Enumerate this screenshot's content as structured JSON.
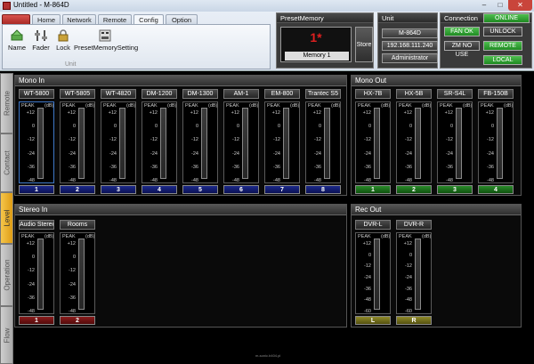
{
  "window": {
    "title": "Untitled - M-864D",
    "min": "–",
    "max": "□",
    "close": "✕"
  },
  "tabs": [
    {
      "label": "",
      "active": false
    },
    {
      "label": "Home",
      "active": false
    },
    {
      "label": "Network",
      "active": false
    },
    {
      "label": "Remote",
      "active": false
    },
    {
      "label": "Config",
      "active": true
    },
    {
      "label": "Option",
      "active": false
    }
  ],
  "ribbon": {
    "buttons": [
      {
        "label": "Name",
        "icon": "name-icon"
      },
      {
        "label": "Fader",
        "icon": "fader-icon"
      },
      {
        "label": "Lock",
        "icon": "lock-icon"
      },
      {
        "label": "PresetMemorySetting",
        "icon": "preset-memory-icon"
      }
    ],
    "group_label": "Unit"
  },
  "preset_memory": {
    "header": "PresetMemory",
    "number": "1*",
    "name": "Memory 1",
    "store_label": "Store"
  },
  "unit": {
    "header": "Unit",
    "model": "M-864D",
    "ip": "192.168.111.240",
    "user": "Administrator"
  },
  "connection": {
    "header": "Connection",
    "status": "ONLINE",
    "fan": "FAN OK",
    "unlock": "UNLOCK",
    "zm": "ZM NO USE",
    "remote": "REMOTE",
    "local": "LOCAL"
  },
  "side_tabs": [
    {
      "label": "Remote",
      "active": false
    },
    {
      "label": "Contact",
      "active": false
    },
    {
      "label": "Level",
      "active": true
    },
    {
      "label": "Operation",
      "active": false
    },
    {
      "label": "Flow",
      "active": false
    }
  ],
  "meter": {
    "peak": "PEAK",
    "unit": "(dB)",
    "ticks": [
      "+12",
      "0",
      "-12",
      "-24",
      "-36",
      "-48"
    ],
    "ticks_rec": [
      "+12",
      "0",
      "-12",
      "-24",
      "-36",
      "-48",
      "-60"
    ]
  },
  "mono_in": {
    "title": "Mono In",
    "channels": [
      {
        "name": "WT-5800",
        "index": "1"
      },
      {
        "name": "WT-5805",
        "index": "2"
      },
      {
        "name": "WT-4820",
        "index": "3"
      },
      {
        "name": "DM-1200",
        "index": "4"
      },
      {
        "name": "DM-1300",
        "index": "5"
      },
      {
        "name": "AM-1",
        "index": "6"
      },
      {
        "name": "EM-800",
        "index": "7"
      },
      {
        "name": "Trantec S5",
        "index": "8"
      }
    ]
  },
  "mono_out": {
    "title": "Mono Out",
    "channels": [
      {
        "name": "HX-7B",
        "index": "1"
      },
      {
        "name": "HX-5B",
        "index": "2"
      },
      {
        "name": "SR-S4L",
        "index": "3"
      },
      {
        "name": "FB-150B",
        "index": "4"
      }
    ]
  },
  "stereo_in": {
    "title": "Stereo In",
    "channels": [
      {
        "name": "Audio Stereo",
        "index": "1"
      },
      {
        "name": "Rooms",
        "index": "2"
      }
    ]
  },
  "rec_out": {
    "title": "Rec Out",
    "channels": [
      {
        "name": "DVR-L",
        "index": "L"
      },
      {
        "name": "DVR-R",
        "index": "R"
      }
    ]
  },
  "footer": "m-sonic.b404.pl"
}
